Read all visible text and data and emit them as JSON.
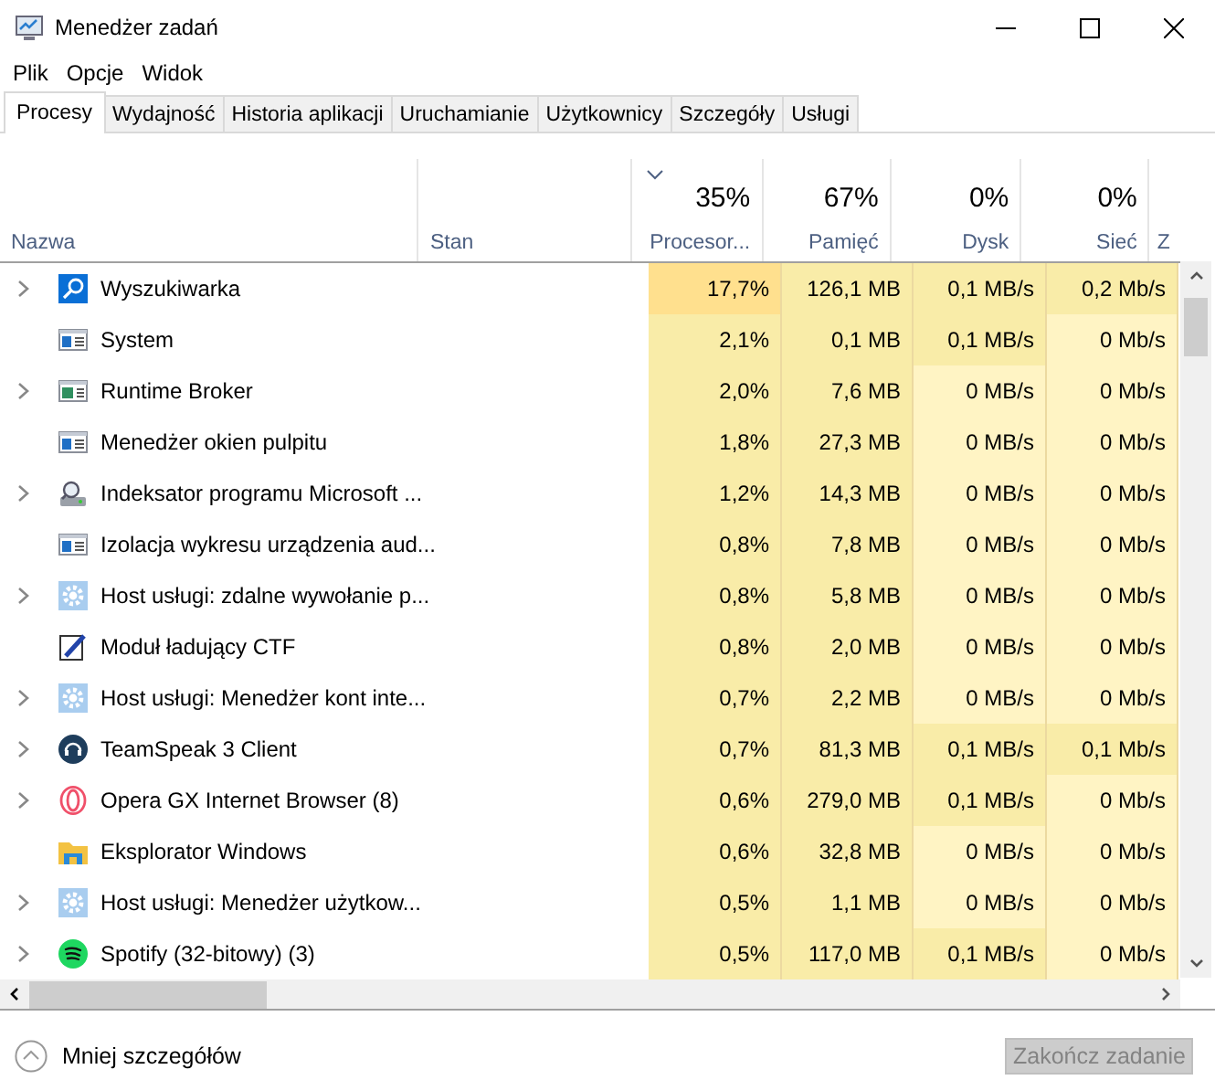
{
  "window": {
    "title": "Menedżer zadań"
  },
  "menu": [
    "Plik",
    "Opcje",
    "Widok"
  ],
  "tabs": [
    {
      "label": "Procesy",
      "selected": true
    },
    {
      "label": "Wydajność",
      "selected": false
    },
    {
      "label": "Historia aplikacji",
      "selected": false
    },
    {
      "label": "Uruchamianie",
      "selected": false
    },
    {
      "label": "Użytkownicy",
      "selected": false
    },
    {
      "label": "Szczegóły",
      "selected": false
    },
    {
      "label": "Usługi",
      "selected": false
    }
  ],
  "table": {
    "columns": [
      {
        "label": "Nazwa",
        "kind": "name"
      },
      {
        "label": "Stan",
        "kind": "text"
      },
      {
        "label": "Procesor...",
        "total": "35%",
        "sorted": true,
        "kind": "metric"
      },
      {
        "label": "Pamięć",
        "total": "67%",
        "sorted": false,
        "kind": "metric"
      },
      {
        "label": "Dysk",
        "total": "0%",
        "sorted": false,
        "kind": "metric"
      },
      {
        "label": "Sieć",
        "total": "0%",
        "sorted": false,
        "kind": "metric"
      },
      {
        "label": "Z",
        "kind": "cut"
      }
    ],
    "rows": [
      {
        "kind": "search",
        "expandable": true,
        "cells": [
          {
            "text": "Wyszukiwarka",
            "kind": "name"
          },
          {
            "text": "",
            "kind": "plain"
          },
          {
            "text": "17,7%",
            "kind": "high"
          },
          {
            "text": "126,1 MB",
            "kind": "mid"
          },
          {
            "text": "0,1 MB/s",
            "kind": "mid"
          },
          {
            "text": "0,2 Mb/s",
            "kind": "mid"
          }
        ]
      },
      {
        "kind": "window",
        "expandable": false,
        "cells": [
          {
            "text": "System",
            "kind": "name"
          },
          {
            "text": "",
            "kind": "plain"
          },
          {
            "text": "2,1%",
            "kind": "mid"
          },
          {
            "text": "0,1 MB",
            "kind": "mid"
          },
          {
            "text": "0,1 MB/s",
            "kind": "mid"
          },
          {
            "text": "0 Mb/s",
            "kind": "low"
          }
        ]
      },
      {
        "kind": "broker",
        "expandable": true,
        "cells": [
          {
            "text": "Runtime Broker",
            "kind": "name"
          },
          {
            "text": "",
            "kind": "plain"
          },
          {
            "text": "2,0%",
            "kind": "mid"
          },
          {
            "text": "7,6 MB",
            "kind": "mid"
          },
          {
            "text": "0 MB/s",
            "kind": "low"
          },
          {
            "text": "0 Mb/s",
            "kind": "low"
          }
        ]
      },
      {
        "kind": "window",
        "expandable": false,
        "cells": [
          {
            "text": "Menedżer okien pulpitu",
            "kind": "name"
          },
          {
            "text": "",
            "kind": "plain"
          },
          {
            "text": "1,8%",
            "kind": "mid"
          },
          {
            "text": "27,3 MB",
            "kind": "mid"
          },
          {
            "text": "0 MB/s",
            "kind": "low"
          },
          {
            "text": "0 Mb/s",
            "kind": "low"
          }
        ]
      },
      {
        "kind": "indexer",
        "expandable": true,
        "cells": [
          {
            "text": "Indeksator programu Microsoft ...",
            "kind": "name"
          },
          {
            "text": "",
            "kind": "plain"
          },
          {
            "text": "1,2%",
            "kind": "mid"
          },
          {
            "text": "14,3 MB",
            "kind": "mid"
          },
          {
            "text": "0 MB/s",
            "kind": "low"
          },
          {
            "text": "0 Mb/s",
            "kind": "low"
          }
        ]
      },
      {
        "kind": "window",
        "expandable": false,
        "cells": [
          {
            "text": "Izolacja wykresu urządzenia aud...",
            "kind": "name"
          },
          {
            "text": "",
            "kind": "plain"
          },
          {
            "text": "0,8%",
            "kind": "mid"
          },
          {
            "text": "7,8 MB",
            "kind": "mid"
          },
          {
            "text": "0 MB/s",
            "kind": "low"
          },
          {
            "text": "0 Mb/s",
            "kind": "low"
          }
        ]
      },
      {
        "kind": "gear",
        "expandable": true,
        "cells": [
          {
            "text": "Host usługi: zdalne wywołanie p...",
            "kind": "name"
          },
          {
            "text": "",
            "kind": "plain"
          },
          {
            "text": "0,8%",
            "kind": "mid"
          },
          {
            "text": "5,8 MB",
            "kind": "mid"
          },
          {
            "text": "0 MB/s",
            "kind": "low"
          },
          {
            "text": "0 Mb/s",
            "kind": "low"
          }
        ]
      },
      {
        "kind": "pen",
        "expandable": false,
        "cells": [
          {
            "text": "Moduł ładujący CTF",
            "kind": "name"
          },
          {
            "text": "",
            "kind": "plain"
          },
          {
            "text": "0,8%",
            "kind": "mid"
          },
          {
            "text": "2,0 MB",
            "kind": "mid"
          },
          {
            "text": "0 MB/s",
            "kind": "low"
          },
          {
            "text": "0 Mb/s",
            "kind": "low"
          }
        ]
      },
      {
        "kind": "gear",
        "expandable": true,
        "cells": [
          {
            "text": "Host usługi: Menedżer kont inte...",
            "kind": "name"
          },
          {
            "text": "",
            "kind": "plain"
          },
          {
            "text": "0,7%",
            "kind": "mid"
          },
          {
            "text": "2,2 MB",
            "kind": "mid"
          },
          {
            "text": "0 MB/s",
            "kind": "low"
          },
          {
            "text": "0 Mb/s",
            "kind": "low"
          }
        ]
      },
      {
        "kind": "headset",
        "expandable": true,
        "cells": [
          {
            "text": "TeamSpeak 3 Client",
            "kind": "name"
          },
          {
            "text": "",
            "kind": "plain"
          },
          {
            "text": "0,7%",
            "kind": "mid"
          },
          {
            "text": "81,3 MB",
            "kind": "mid"
          },
          {
            "text": "0,1 MB/s",
            "kind": "mid"
          },
          {
            "text": "0,1 Mb/s",
            "kind": "mid"
          }
        ]
      },
      {
        "kind": "ring",
        "expandable": true,
        "cells": [
          {
            "text": "Opera GX Internet Browser (8)",
            "kind": "name"
          },
          {
            "text": "",
            "kind": "plain"
          },
          {
            "text": "0,6%",
            "kind": "mid"
          },
          {
            "text": "279,0 MB",
            "kind": "mid"
          },
          {
            "text": "0,1 MB/s",
            "kind": "mid"
          },
          {
            "text": "0 Mb/s",
            "kind": "low"
          }
        ]
      },
      {
        "kind": "folder",
        "expandable": false,
        "cells": [
          {
            "text": "Eksplorator Windows",
            "kind": "name"
          },
          {
            "text": "",
            "kind": "plain"
          },
          {
            "text": "0,6%",
            "kind": "mid"
          },
          {
            "text": "32,8 MB",
            "kind": "mid"
          },
          {
            "text": "0 MB/s",
            "kind": "low"
          },
          {
            "text": "0 Mb/s",
            "kind": "low"
          }
        ]
      },
      {
        "kind": "gear",
        "expandable": true,
        "cells": [
          {
            "text": "Host usługi: Menedżer użytkow...",
            "kind": "name"
          },
          {
            "text": "",
            "kind": "plain"
          },
          {
            "text": "0,5%",
            "kind": "mid"
          },
          {
            "text": "1,1 MB",
            "kind": "mid"
          },
          {
            "text": "0 MB/s",
            "kind": "low"
          },
          {
            "text": "0 Mb/s",
            "kind": "low"
          }
        ]
      },
      {
        "kind": "spotify",
        "expandable": true,
        "cells": [
          {
            "text": "Spotify (32-bitowy) (3)",
            "kind": "name"
          },
          {
            "text": "",
            "kind": "plain"
          },
          {
            "text": "0,5%",
            "kind": "mid"
          },
          {
            "text": "117,0 MB",
            "kind": "mid"
          },
          {
            "text": "0,1 MB/s",
            "kind": "mid"
          },
          {
            "text": "0 Mb/s",
            "kind": "low"
          }
        ]
      }
    ]
  },
  "footer": {
    "details_toggle": "Mniej szczegółów",
    "end_task": {
      "label": "Zakończ zadanie",
      "disabled": true
    }
  }
}
